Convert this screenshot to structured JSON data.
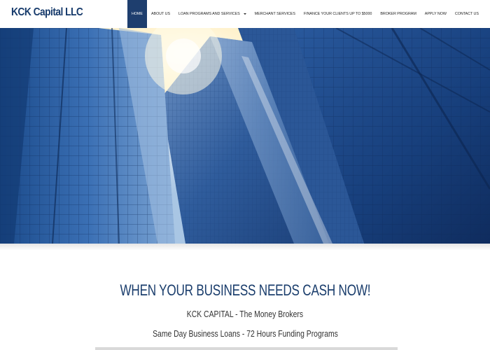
{
  "site": {
    "logo": "KCK Capital LLC"
  },
  "nav": {
    "items": [
      {
        "label": "HOME",
        "active": true
      },
      {
        "label": "ABOUT US"
      },
      {
        "label": "LOAN PROGRAMS AND SERVICES",
        "dropdown": true
      },
      {
        "label": "MERCHANT SERVICES"
      },
      {
        "label": "FINANCE YOUR CLIENTS UP TO $5000"
      },
      {
        "label": "BROKER PROGRAM"
      },
      {
        "label": "APPLY NOW"
      },
      {
        "label": "CONTACT US"
      }
    ]
  },
  "main": {
    "headline": "WHEN YOUR BUSINESS NEEDS CASH NOW!",
    "tagline": "KCK CAPITAL - The Money Brokers",
    "subtagline": "Same Day Business Loans - 72 Hours Funding Programs"
  },
  "colors": {
    "brand": "#163a6b",
    "nav_active": "#1e3e6e",
    "hero_sky": "#fff6dc",
    "hero_glass": "#1a3f7a"
  },
  "icons": {
    "dropdown": "chevron-down-icon"
  }
}
